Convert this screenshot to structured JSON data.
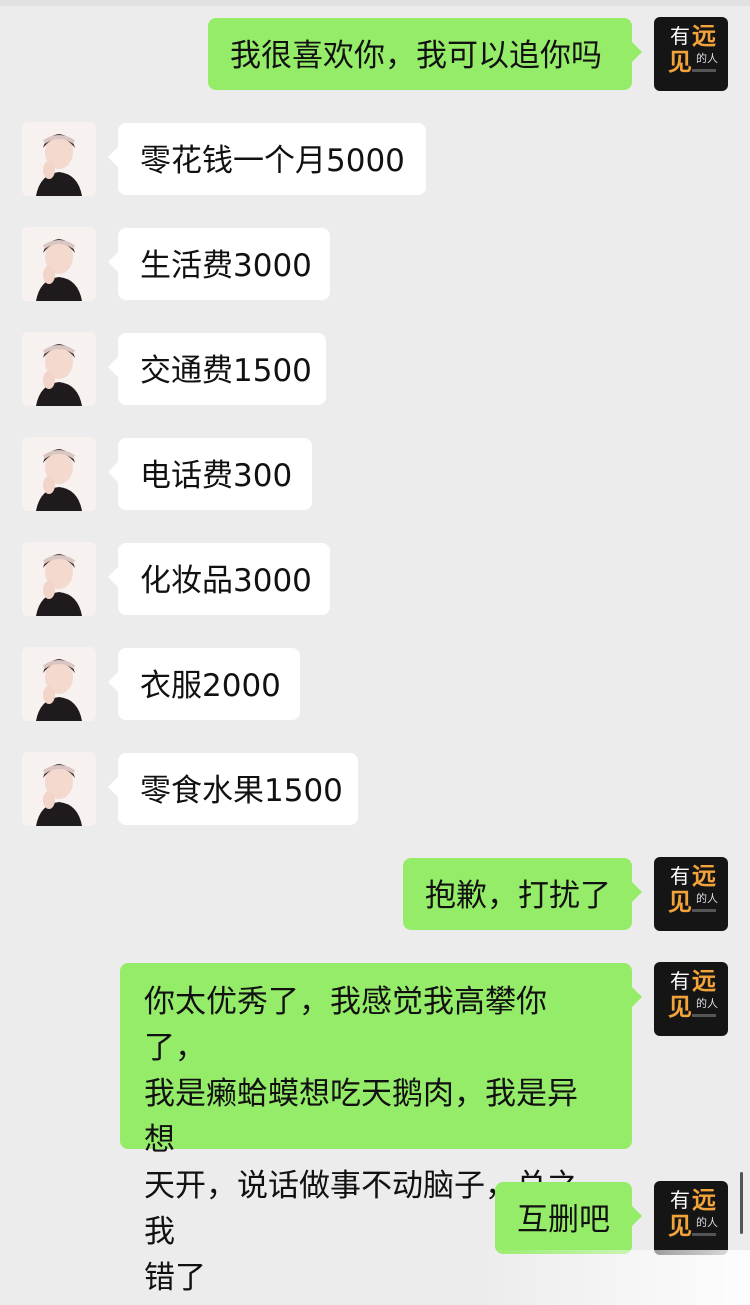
{
  "chat": {
    "messages": [
      {
        "side": "out",
        "text": "我很喜欢你，我可以追你吗"
      },
      {
        "side": "in",
        "text": "零花钱一个月5000"
      },
      {
        "side": "in",
        "text": "生活费3000"
      },
      {
        "side": "in",
        "text": "交通费1500"
      },
      {
        "side": "in",
        "text": "电话费300"
      },
      {
        "side": "in",
        "text": "化妆品3000"
      },
      {
        "side": "in",
        "text": "衣服2000"
      },
      {
        "side": "in",
        "text": "零食水果1500"
      },
      {
        "side": "out",
        "text": "抱歉，打扰了"
      },
      {
        "side": "out",
        "lines": [
          "你太优秀了，我感觉我高攀你了，",
          "我是癞蛤蟆想吃天鹅肉，我是异想",
          "天开，说话做事不动脑子，总之我",
          "错了"
        ]
      },
      {
        "side": "out",
        "text": "互删吧"
      }
    ]
  },
  "avatars": {
    "her": {
      "icon": "woman-portrait-avatar"
    },
    "me": {
      "icon": "youyuanjian-logo-avatar",
      "logo_chars": [
        "有",
        "远",
        "见",
        "的人"
      ]
    }
  },
  "colors": {
    "background": "#ececec",
    "incoming_bubble": "#ffffff",
    "outgoing_bubble": "#95ec69",
    "logo_orange": "#f2a33a"
  }
}
